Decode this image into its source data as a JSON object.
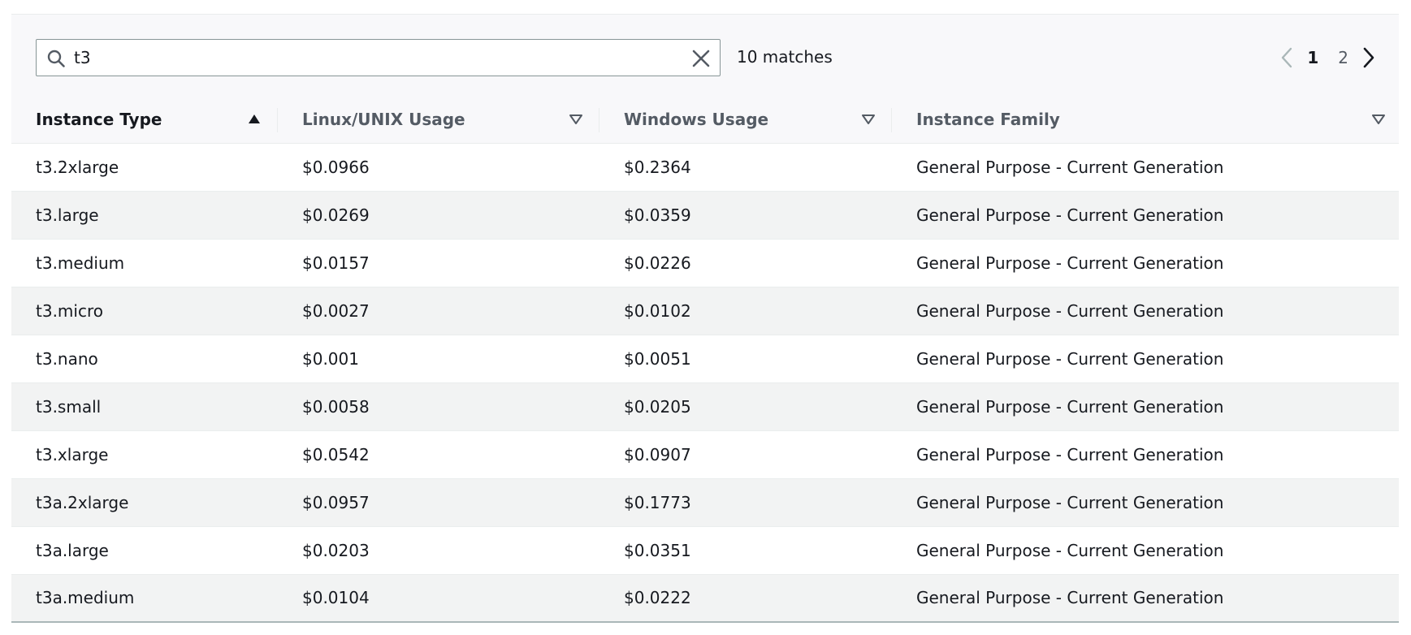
{
  "search": {
    "value": "t3",
    "matches_text": "10 matches"
  },
  "icons": {
    "search": "search-icon",
    "clear": "close-icon",
    "prev": "chevron-left-icon",
    "next": "chevron-right-icon",
    "sort_asc": "caret-up-filled-icon",
    "sort_none": "caret-down-outline-icon"
  },
  "pagination": {
    "pages": [
      "1",
      "2"
    ],
    "current": "1"
  },
  "table": {
    "columns": [
      "Instance Type",
      "Linux/UNIX Usage",
      "Windows Usage",
      "Instance Family"
    ],
    "rows": [
      [
        "t3.2xlarge",
        "$0.0966",
        "$0.2364",
        "General Purpose - Current Generation"
      ],
      [
        "t3.large",
        "$0.0269",
        "$0.0359",
        "General Purpose - Current Generation"
      ],
      [
        "t3.medium",
        "$0.0157",
        "$0.0226",
        "General Purpose - Current Generation"
      ],
      [
        "t3.micro",
        "$0.0027",
        "$0.0102",
        "General Purpose - Current Generation"
      ],
      [
        "t3.nano",
        "$0.001",
        "$0.0051",
        "General Purpose - Current Generation"
      ],
      [
        "t3.small",
        "$0.0058",
        "$0.0205",
        "General Purpose - Current Generation"
      ],
      [
        "t3.xlarge",
        "$0.0542",
        "$0.0907",
        "General Purpose - Current Generation"
      ],
      [
        "t3a.2xlarge",
        "$0.0957",
        "$0.1773",
        "General Purpose - Current Generation"
      ],
      [
        "t3a.large",
        "$0.0203",
        "$0.0351",
        "General Purpose - Current Generation"
      ],
      [
        "t3a.medium",
        "$0.0104",
        "$0.0222",
        "General Purpose - Current Generation"
      ]
    ]
  },
  "colors": {
    "text": "#16191f",
    "muted": "#545b64",
    "row_alt": "#f2f3f3",
    "header_bg": "#f8f8fa",
    "border": "#879596"
  }
}
